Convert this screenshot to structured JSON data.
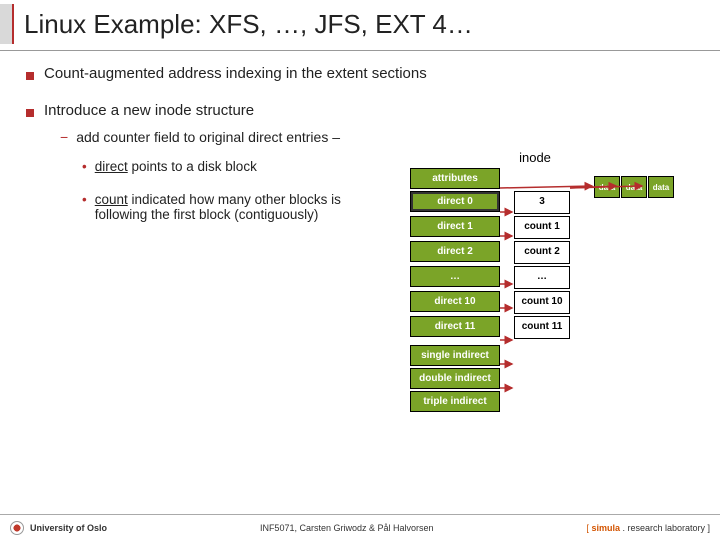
{
  "title": "Linux Example: XFS, …, JFS, EXT 4…",
  "bullets": {
    "b1": "Count-augmented address indexing in the extent sections",
    "b2": "Introduce a new inode structure"
  },
  "sub": {
    "s1a": "add counter field to original direct entries –",
    "s2a_pre": "direct",
    "s2a_post": " points to a disk block",
    "s2b_pre": "count",
    "s2b_post": " indicated how many other blocks is following the first block (contiguously)"
  },
  "diagram": {
    "label": "inode",
    "attributes": "attributes",
    "rows": [
      {
        "direct": "direct 0",
        "count": "3"
      },
      {
        "direct": "direct 1",
        "count": "count 1"
      },
      {
        "direct": "direct 2",
        "count": "count 2"
      },
      {
        "direct": "…",
        "count": "…"
      },
      {
        "direct": "direct 10",
        "count": "count 10"
      },
      {
        "direct": "direct 11",
        "count": "count 11"
      }
    ],
    "indirect": [
      "single indirect",
      "double indirect",
      "triple indirect"
    ],
    "data": [
      "data",
      "data",
      "data"
    ]
  },
  "footer": {
    "left": "University of Oslo",
    "center": "INF5071, Carsten Griwodz & Pål Halvorsen",
    "right_prefix": "[ ",
    "right_brand": "simula",
    "right_suffix": " . research laboratory ]"
  }
}
